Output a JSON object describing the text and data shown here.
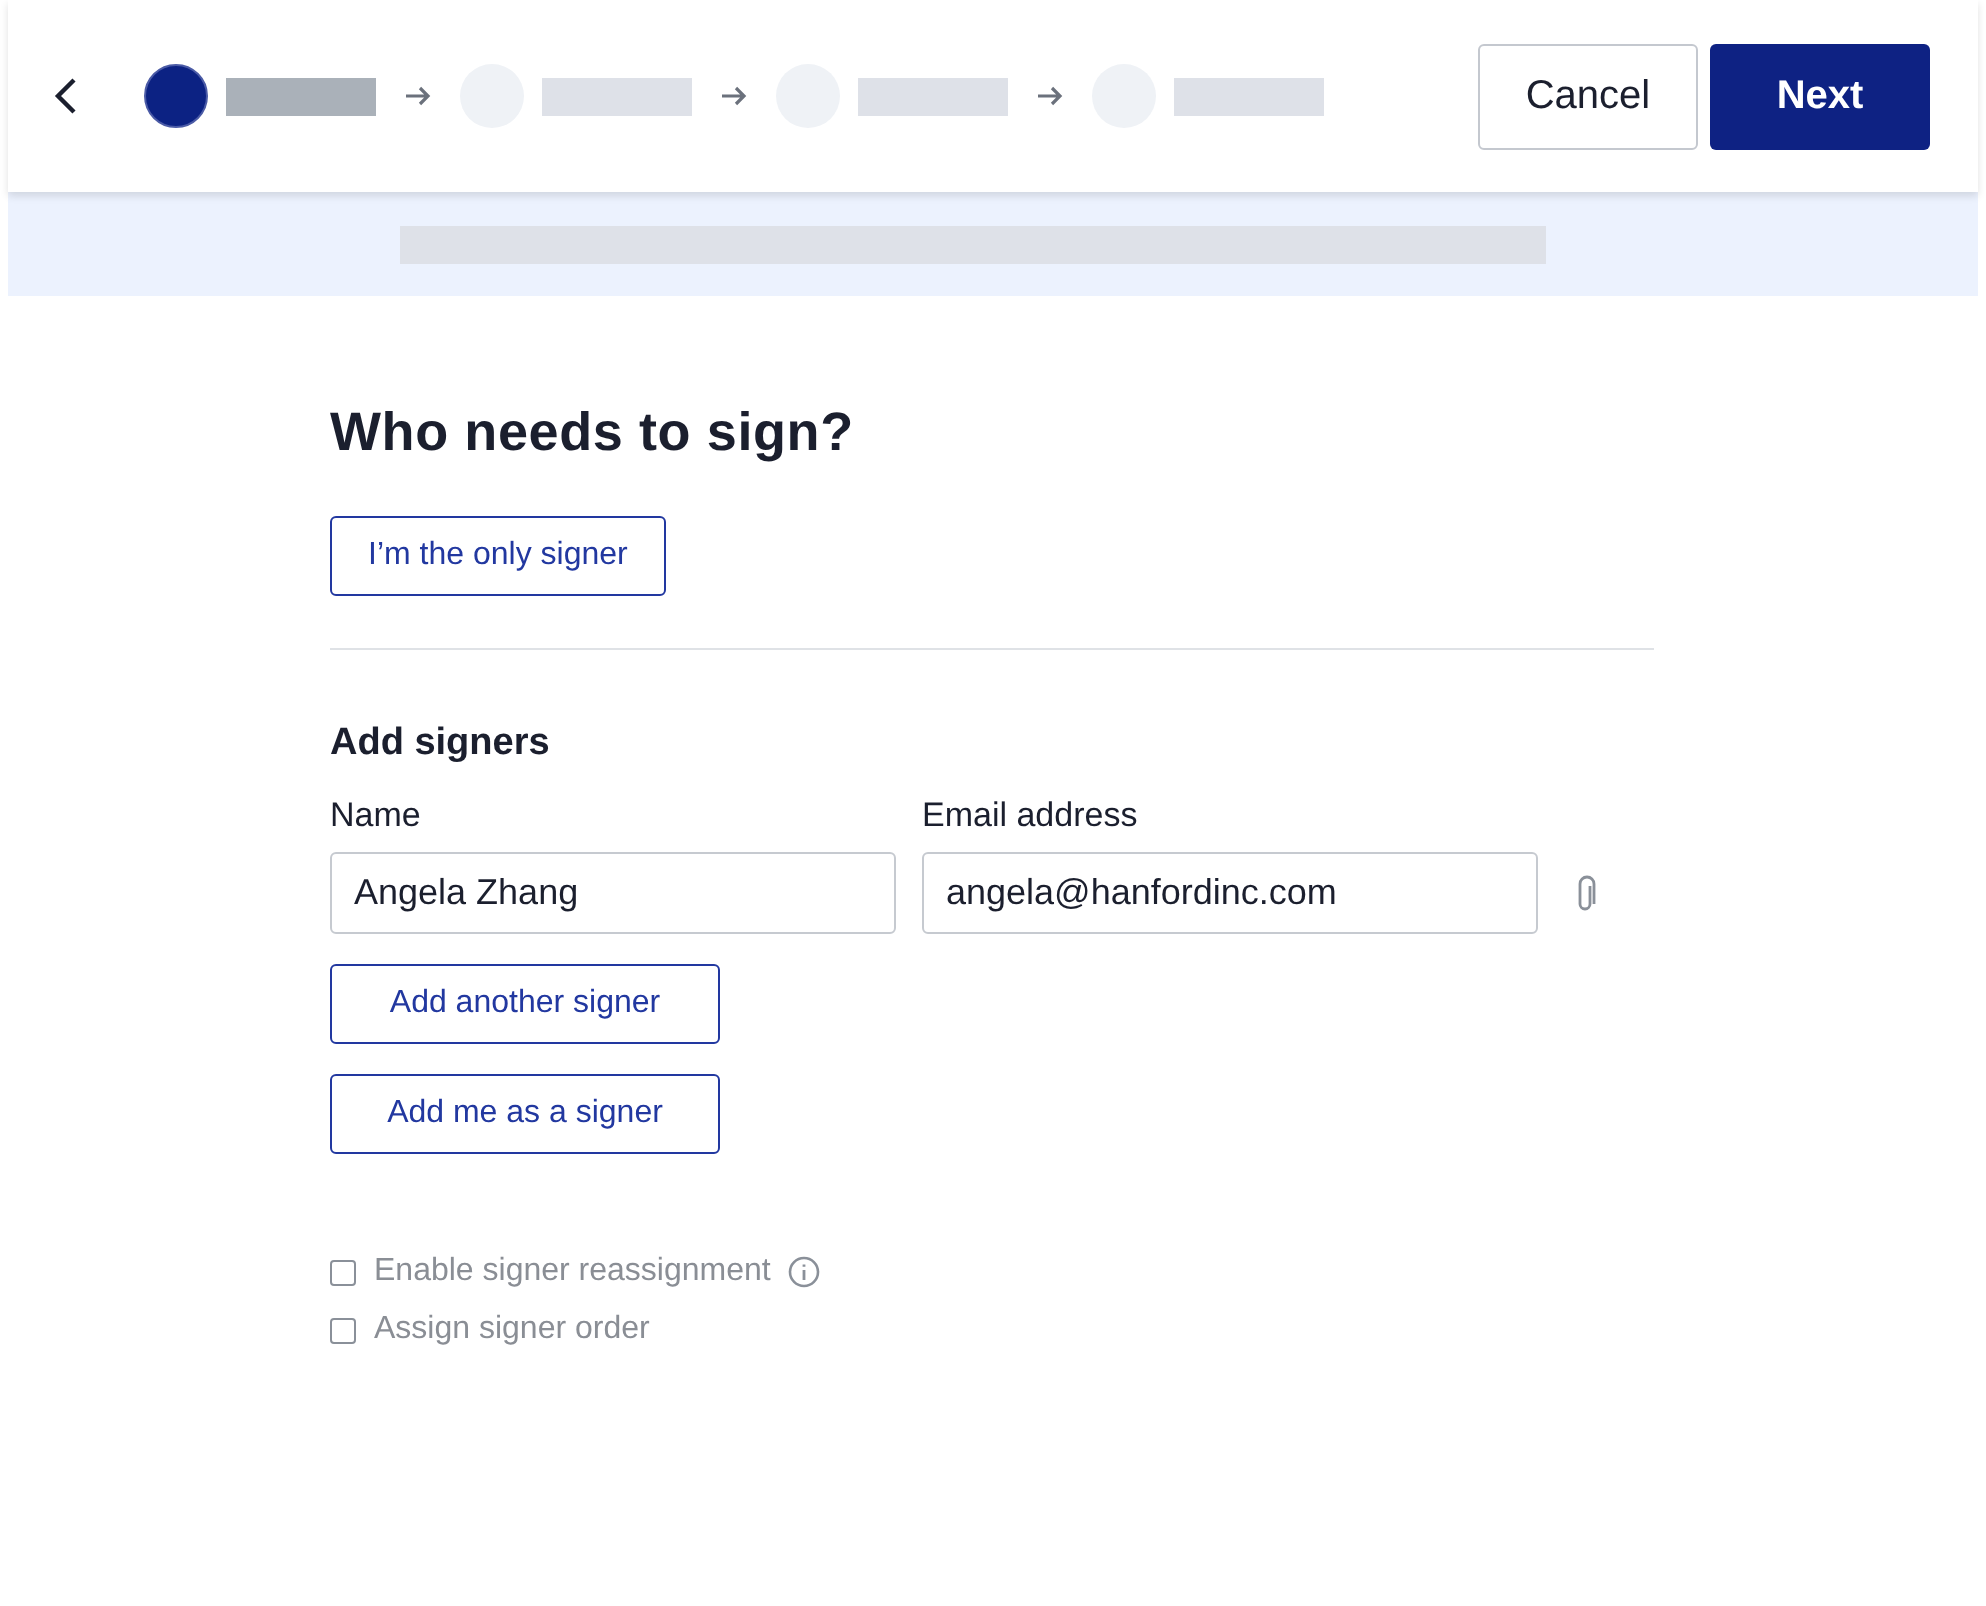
{
  "steps": [
    {
      "selected": true
    },
    {
      "selected": false
    },
    {
      "selected": false
    },
    {
      "selected": false
    }
  ],
  "buttons": {
    "cancel": "Cancel",
    "next": "Next"
  },
  "heading": "Who needs to sign?",
  "only_signer_button": "I’m the only signer",
  "section_title": "Add signers",
  "columns": {
    "name": "Name",
    "email": "Email address"
  },
  "signers": [
    {
      "name": "Angela Zhang",
      "email": "angela@hanfordinc.com"
    }
  ],
  "actions": [
    "Add another signer",
    "Add me as a signer"
  ],
  "options": [
    {
      "label": "Enable signer reassignment",
      "checked": false,
      "kind": "info"
    },
    {
      "label": "Assign signer order",
      "checked": false,
      "kind": "plain"
    }
  ]
}
